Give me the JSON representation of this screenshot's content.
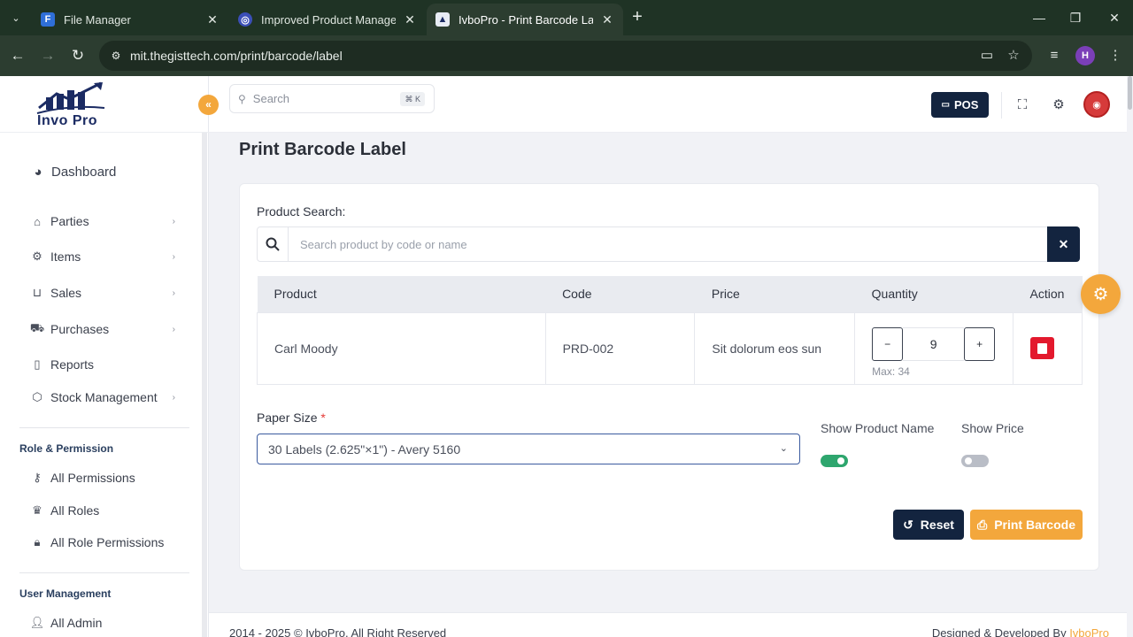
{
  "browser": {
    "tabs": [
      {
        "title": "File Manager",
        "active": false
      },
      {
        "title": "Improved Product Managemen",
        "active": false
      },
      {
        "title": "IvboPro - Print Barcode Label",
        "active": true
      }
    ],
    "url": "mit.thegisttech.com/print/barcode/label",
    "profile_initial": "H"
  },
  "app": {
    "logo_text": "Invo Pro",
    "search": {
      "placeholder": "Search",
      "shortcut": "⌘ K"
    },
    "pos_label": "POS"
  },
  "sidebar": {
    "dashboard": "Dashboard",
    "items": [
      {
        "label": "Parties",
        "icon": "tag-icon",
        "has_submenu": true
      },
      {
        "label": "Items",
        "icon": "gear-icon",
        "has_submenu": true
      },
      {
        "label": "Sales",
        "icon": "basket-icon",
        "has_submenu": true
      },
      {
        "label": "Purchases",
        "icon": "truck-icon",
        "has_submenu": true
      },
      {
        "label": "Reports",
        "icon": "file-icon",
        "has_submenu": false
      },
      {
        "label": "Stock Management",
        "icon": "box-icon",
        "has_submenu": true
      }
    ],
    "sections": [
      {
        "title": "Role & Permission",
        "items": [
          {
            "label": "All Permissions",
            "icon": "key-icon"
          },
          {
            "label": "All Roles",
            "icon": "crown-icon"
          },
          {
            "label": "All Role Permissions",
            "icon": "lock-icon"
          }
        ]
      },
      {
        "title": "User Management",
        "items": [
          {
            "label": "All Admin",
            "icon": "user-icon"
          }
        ]
      }
    ]
  },
  "page": {
    "title": "Print Barcode Label",
    "product_search_label": "Product Search:",
    "product_search_placeholder": "Search product by code or name",
    "table": {
      "headers": [
        "Product",
        "Code",
        "Price",
        "Quantity",
        "Action"
      ],
      "rows": [
        {
          "product": "Carl Moody",
          "code": "PRD-002",
          "price": "Sit dolorum eos sun",
          "quantity": "9",
          "max": "Max: 34"
        }
      ]
    },
    "paper_size_label": "Paper Size",
    "paper_size_required": "*",
    "paper_size_value": "30 Labels (2.625\"×1\") - Avery 5160",
    "show_product_name_label": "Show Product Name",
    "show_product_name": true,
    "show_price_label": "Show Price",
    "show_price": false,
    "reset_label": "Reset",
    "print_label": "Print Barcode"
  },
  "footer": {
    "copyright": "2014 - 2025 © IvboPro. All Right Reserved",
    "credit_prefix": "Designed & Developed By ",
    "credit_brand": "IvboPro"
  },
  "colors": {
    "accent": "#f3a73c",
    "primary": "#13243f",
    "danger": "#e3192d",
    "success": "#2ea66e"
  }
}
